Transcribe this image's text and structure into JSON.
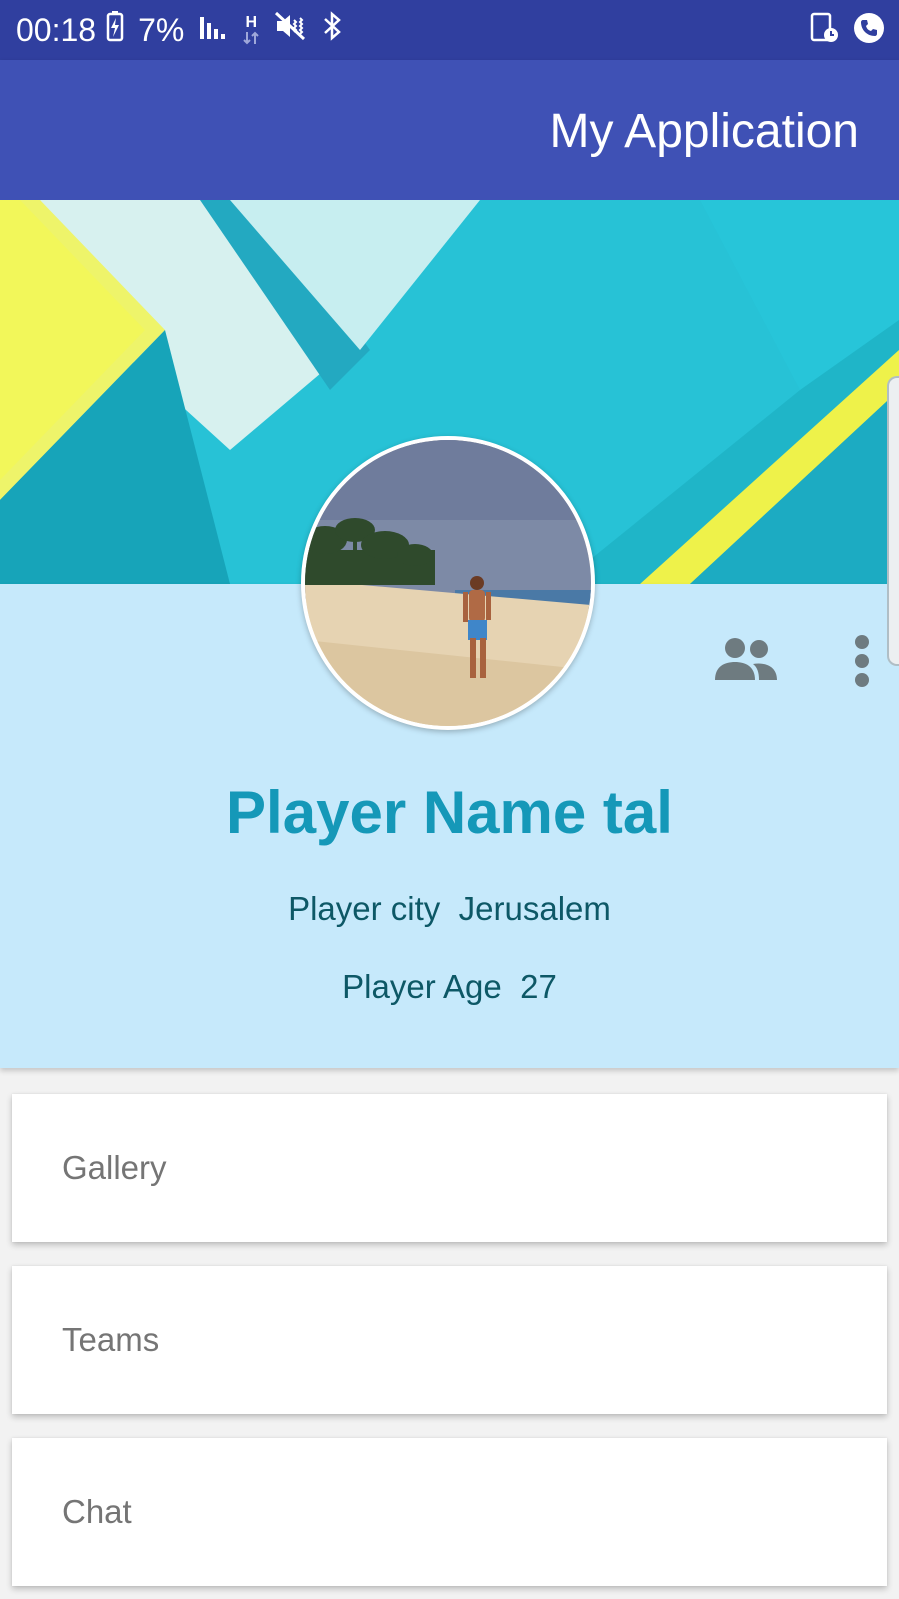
{
  "status_bar": {
    "time": "00:18",
    "battery": "7%",
    "network": "H",
    "icons": [
      "battery-charging-icon",
      "signal-icon",
      "network-h-icon",
      "mute-vibrate-icon",
      "bluetooth-icon",
      "screen-timer-icon",
      "call-icon"
    ]
  },
  "app_bar": {
    "title": "My Application"
  },
  "profile": {
    "name": "Player Name tal",
    "city_label": "Player city",
    "city_value": "Jerusalem",
    "age_label": "Player Age",
    "age_value": "27",
    "actions": [
      "friends-icon",
      "more-vert-icon"
    ]
  },
  "menu": {
    "items": [
      {
        "label": "Gallery"
      },
      {
        "label": "Teams"
      },
      {
        "label": "Chat"
      }
    ]
  },
  "colors": {
    "status_bar": "#303f9f",
    "app_bar": "#3f51b5",
    "profile_panel": "#c6e9fb",
    "name_text": "#1598b8",
    "info_text": "#0d5866",
    "menu_text": "#757575"
  }
}
